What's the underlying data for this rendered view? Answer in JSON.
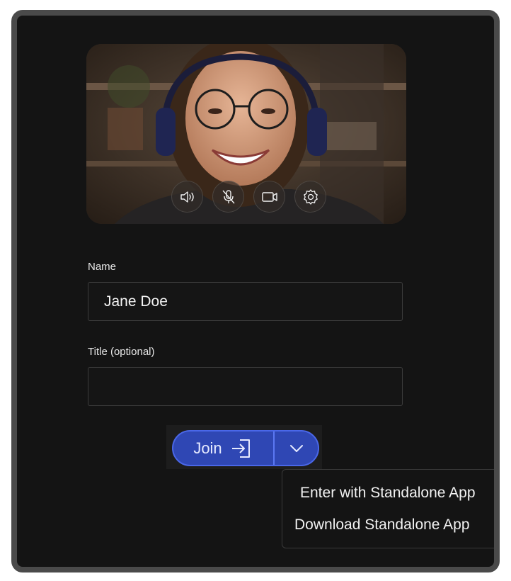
{
  "preview": {
    "controls": [
      {
        "name": "speaker-icon"
      },
      {
        "name": "microphone-muted-icon"
      },
      {
        "name": "camera-icon"
      },
      {
        "name": "settings-gear-icon"
      }
    ]
  },
  "form": {
    "name_label": "Name",
    "name_value": "Jane Doe",
    "title_label": "Title (optional)",
    "title_value": ""
  },
  "join": {
    "label": "Join",
    "icon": "sign-in-icon",
    "dropdown_icon": "chevron-down-icon"
  },
  "menu": {
    "items": [
      {
        "label": "Enter with Standalone App"
      },
      {
        "label": "Download Standalone App"
      }
    ]
  },
  "colors": {
    "background": "#141414",
    "frame_border": "#4a4a4a",
    "join_fill": "#2f47b4",
    "join_border": "#4a67e8"
  }
}
